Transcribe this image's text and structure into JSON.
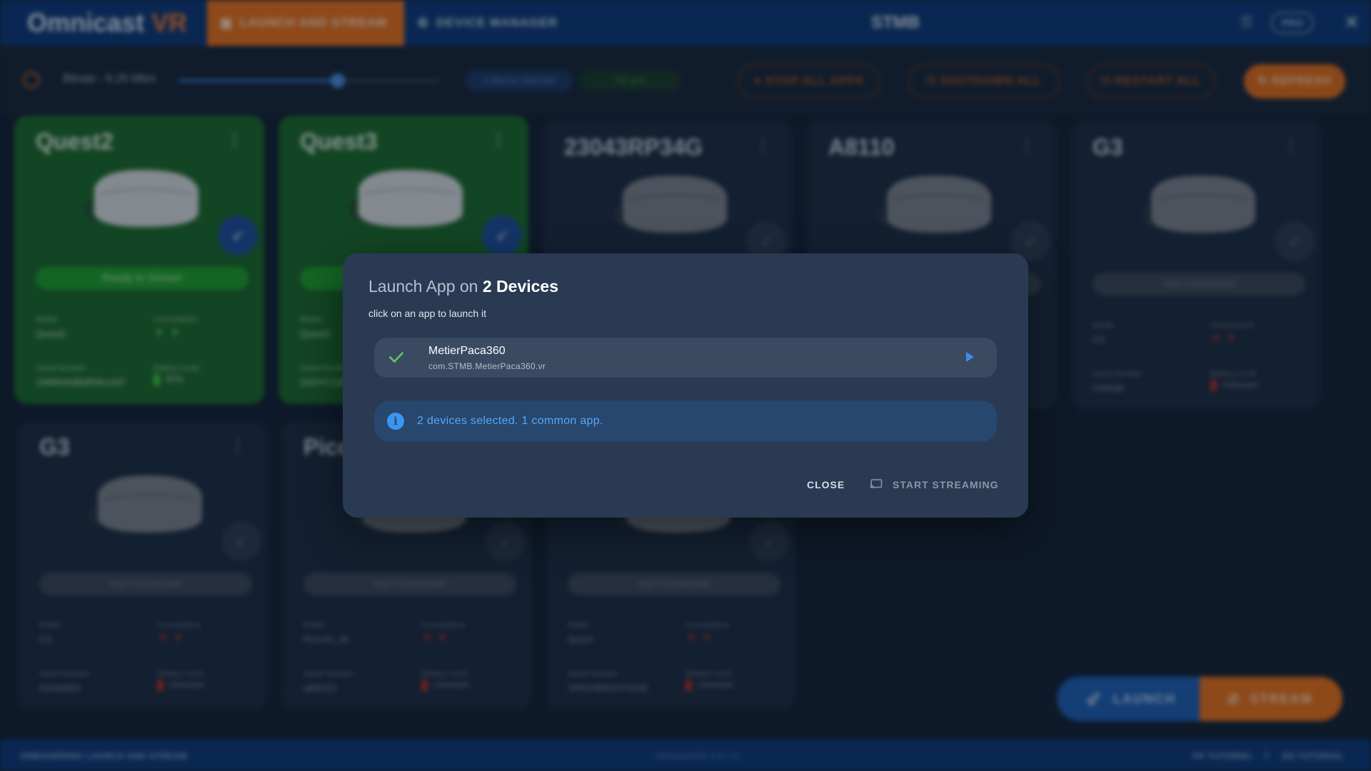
{
  "app": {
    "title_main": "Omnicast",
    "title_accent": "VR",
    "tabs": [
      {
        "label": "LAUNCH AND STREAM",
        "icon": "grid-icon"
      },
      {
        "label": "DEVICE MANAGER",
        "icon": "gear-icon"
      }
    ],
    "org": "STMB",
    "badge": "PRO",
    "close_glyph": "✕"
  },
  "toolbar": {
    "bitrate_label": "Bitrate - 6.25 Mb/s",
    "bitrate_fraction": 0.61,
    "selected_pill": "2 device selected",
    "gpu_pill": "full grid",
    "stop_all": "STOP ALL APPS",
    "shutdown_all": "SHUTDOWN ALL",
    "restart_all": "RESTART ALL",
    "refresh": "REFRESH"
  },
  "labels": {
    "model": "Model",
    "connection": "Connections",
    "serial": "Serial Number",
    "battery": "Battery Level"
  },
  "devices": [
    {
      "name": "Quest2",
      "status": "Ready to Stream",
      "model": "Quest2",
      "serial": "1WMHA0B0R0K1437",
      "battery": "81%",
      "connected": true
    },
    {
      "name": "Quest3",
      "status": "Ready to Stream",
      "model": "Quest3",
      "serial": "2G0YC1ZE",
      "battery": "",
      "connected": true
    },
    {
      "name": "23043RP34G",
      "status": "Not Connected",
      "model": "",
      "serial": "",
      "battery": "Unknown",
      "connected": false
    },
    {
      "name": "A8110",
      "status": "Not Connected",
      "model": "",
      "serial": "",
      "battery": "Unknown",
      "connected": false
    },
    {
      "name": "G3",
      "status": "Not Connected",
      "model": "G3",
      "serial": "2346d8",
      "battery": "Unknown",
      "connected": false
    },
    {
      "name": "G3",
      "status": "Not Connected",
      "model": "G3",
      "serial": "AAA9AE5",
      "battery": "Unknown",
      "connected": false
    },
    {
      "name": "Pico",
      "status": "Not Connected",
      "model": "Pico4U_4K",
      "serial": "a8f2021",
      "battery": "Unknown",
      "connected": false
    },
    {
      "name": "",
      "status": "Not Connected",
      "model": "Quest",
      "serial": "1PASH8AC0Y9138",
      "battery": "Unknown",
      "connected": false
    }
  ],
  "bottom": {
    "launch": "LAUNCH",
    "stream": "STREAM"
  },
  "footer": {
    "left": "ONBOARDING LAUNCH AND STREAM",
    "center": "OmnicastVR 2.0.7.0",
    "right1": "FR TUTORIEL",
    "sep": "|",
    "right2": "EN TUTORIAL"
  },
  "modal": {
    "title_prefix": "Launch App on",
    "title_bold": "2 Devices",
    "subtitle": "click on an app to launch it",
    "apps": [
      {
        "name": "MetierPaca360",
        "package": "com.STMB.MetierPaca360.vr",
        "checked": true
      }
    ],
    "info": "2 devices selected. 1 common app.",
    "close": "CLOSE",
    "start_streaming": "START STREAMING"
  },
  "colors": {
    "accent_orange": "#e8721c",
    "brand_blue": "#0d3a7a",
    "ready_green": "#1fa12e",
    "info_blue": "#57a7f5"
  }
}
